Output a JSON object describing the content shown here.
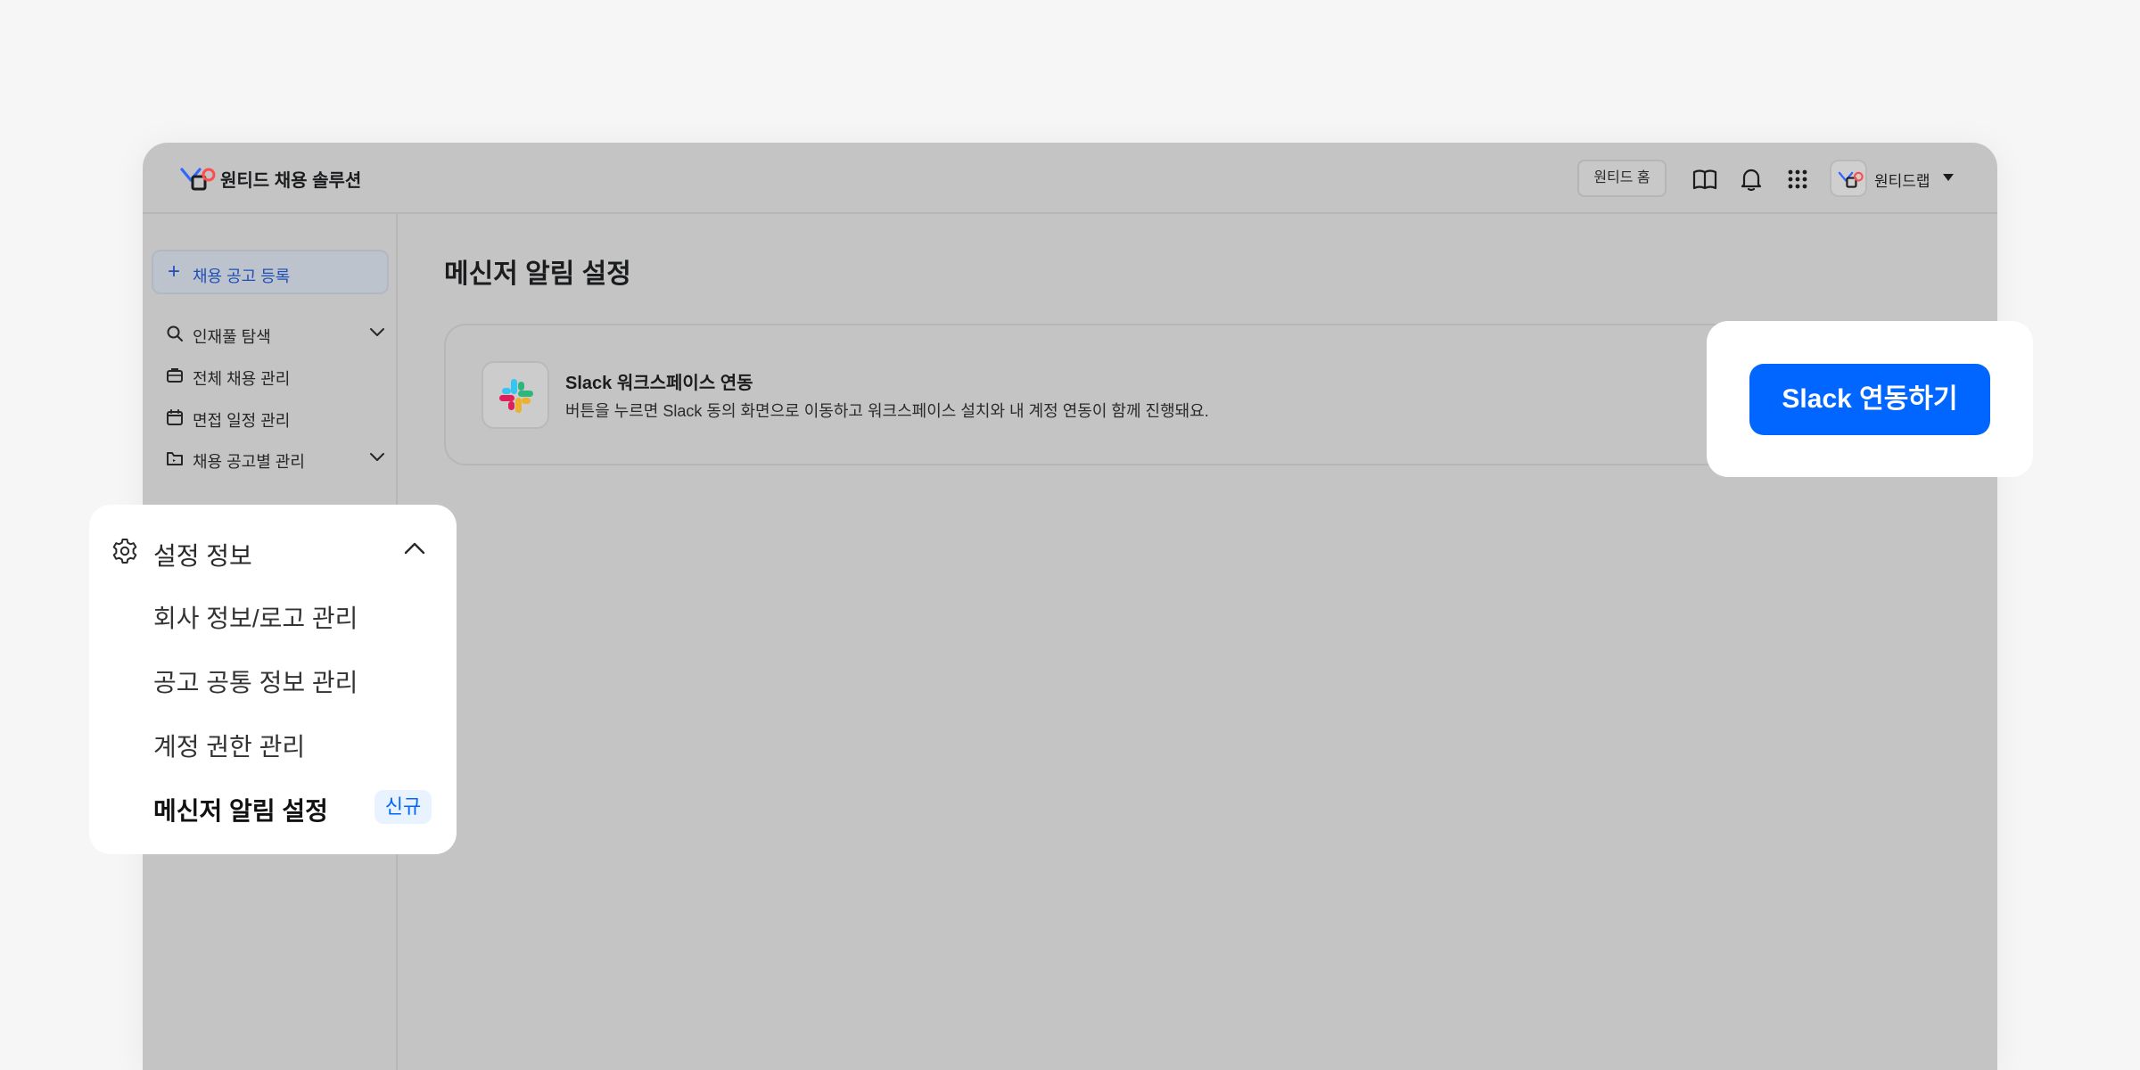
{
  "header": {
    "brand": "원티드 채용 솔루션",
    "home_button": "원티드 홈",
    "user_name": "원티드랩"
  },
  "sidebar": {
    "post_job_button": "채용 공고 등록",
    "items": [
      {
        "label": "인재풀 탐색",
        "icon": "search-icon",
        "expandable": true
      },
      {
        "label": "전체 채용 관리",
        "icon": "briefcase-icon",
        "expandable": false
      },
      {
        "label": "면접 일정 관리",
        "icon": "calendar-icon",
        "expandable": false
      },
      {
        "label": "채용 공고별 관리",
        "icon": "folder-icon",
        "expandable": true
      }
    ]
  },
  "main": {
    "page_title": "메신저 알림 설정",
    "slack_card": {
      "title": "Slack 워크스페이스 연동",
      "description": "버튼을 누르면 Slack 동의 화면으로 이동하고 워크스페이스 설치와 내 계정 연동이 함께 진행돼요."
    }
  },
  "connect_popup": {
    "button_label": "Slack 연동하기",
    "button_color": "#0066ff"
  },
  "settings_popup": {
    "header": "설정 정보",
    "items": [
      {
        "label": "회사 정보/로고 관리",
        "active": false
      },
      {
        "label": "공고 공통 정보 관리",
        "active": false
      },
      {
        "label": "계정 권한 관리",
        "active": false
      },
      {
        "label": "메신저 알림 설정",
        "active": true
      }
    ],
    "new_badge": "신규"
  }
}
